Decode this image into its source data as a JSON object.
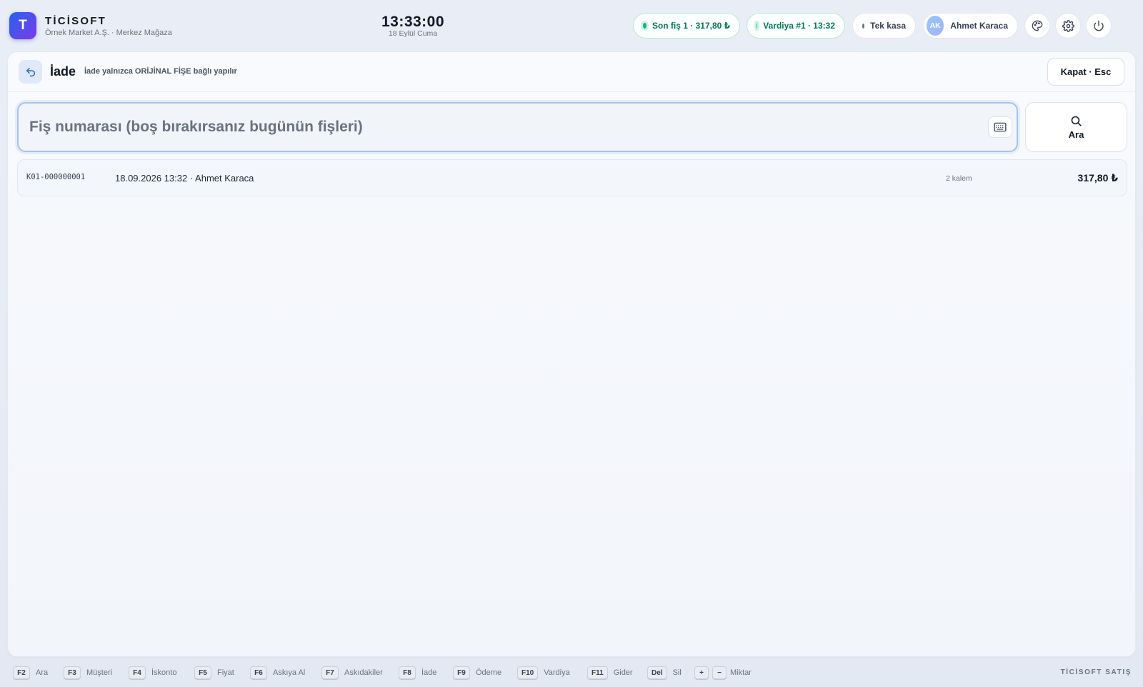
{
  "header": {
    "logo_letter": "T",
    "brand_name": "TİCİSOFT",
    "brand_sub": "Örnek Market A.Ş. · Merkez Mağaza",
    "clock": "13:33:00",
    "date": "18 Eylül Cuma",
    "last_receipt": "Son fiş 1 · 317,80 ₺",
    "shift": "Vardiya #1 · 13:32",
    "register_mode": "Tek kasa",
    "user_initials": "AK",
    "user_name": "Ahmet Karaca",
    "icons": [
      "palette-icon",
      "gear-icon",
      "power-icon"
    ]
  },
  "panel": {
    "title": "İade",
    "subtitle": "İade yalnızca ORİJİNAL FİŞE bağlı yapılır",
    "close_label": "Kapat · Esc",
    "search": {
      "placeholder": "Fiş numarası (boş bırakırsanız bugünün fişleri)",
      "value": "",
      "button_label": "Ara"
    },
    "receipts": [
      {
        "number": "K01-000000001",
        "meta": "18.09.2026 13:32 · Ahmet Karaca",
        "count": "2 kalem",
        "total": "317,80 ₺"
      }
    ]
  },
  "footer": {
    "shortcuts": [
      {
        "key": "F2",
        "label": "Ara"
      },
      {
        "key": "F3",
        "label": "Müşteri"
      },
      {
        "key": "F4",
        "label": "İskonto"
      },
      {
        "key": "F5",
        "label": "Fiyat"
      },
      {
        "key": "F6",
        "label": "Askıya Al"
      },
      {
        "key": "F7",
        "label": "Askıdakiler"
      },
      {
        "key": "F8",
        "label": "İade"
      },
      {
        "key": "F9",
        "label": "Ödeme"
      },
      {
        "key": "F10",
        "label": "Vardiya"
      },
      {
        "key": "F11",
        "label": "Gider"
      },
      {
        "key": "Del",
        "label": "Sil"
      }
    ],
    "qty_plus": "+",
    "qty_minus": "−",
    "qty_label": "Miktar",
    "brand": "TİCİSOFT SATIŞ"
  },
  "colors": {
    "accent": "#2563eb",
    "success": "#10b981",
    "success_text": "#047857"
  }
}
